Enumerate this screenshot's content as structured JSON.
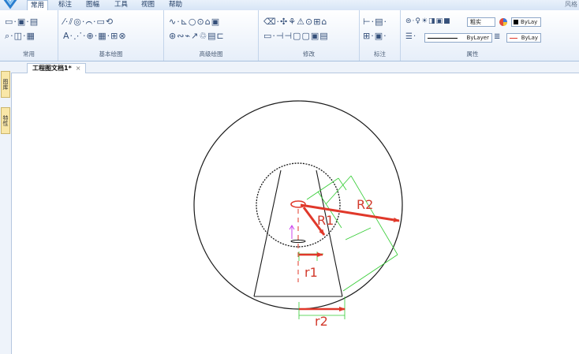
{
  "menu": {
    "tabs": [
      "常用",
      "标注",
      "图幅",
      "工具",
      "视图",
      "帮助"
    ],
    "active_tab": "常用",
    "style_label": "风格"
  },
  "ribbon": {
    "groups": [
      {
        "label": "常用"
      },
      {
        "label": "基本绘图"
      },
      {
        "label": "高级绘图"
      },
      {
        "label": "修改"
      },
      {
        "label": "标注"
      },
      {
        "label": "属性"
      }
    ],
    "properties": {
      "linewidth_label": "粗实",
      "color_value": "ByLay",
      "linetype_value": "ByLayer",
      "lineweight_value": "ByLay"
    }
  },
  "left_dock": {
    "tabs": [
      "图库",
      "特性"
    ]
  },
  "document": {
    "tab_title": "工程图文档1*",
    "close_symbol": "×"
  },
  "drawing": {
    "labels": {
      "R2": "R2",
      "R1": "R1",
      "r1": "r1",
      "r2": "r2"
    },
    "colors": {
      "geometry": "#1a1a1a",
      "arrow": "#e0382a",
      "dimension": "#33cc33",
      "marker": "#cc44ee"
    }
  },
  "colors": {
    "ribbon_bg": "#e6eef9",
    "accent": "#1f3b63"
  }
}
